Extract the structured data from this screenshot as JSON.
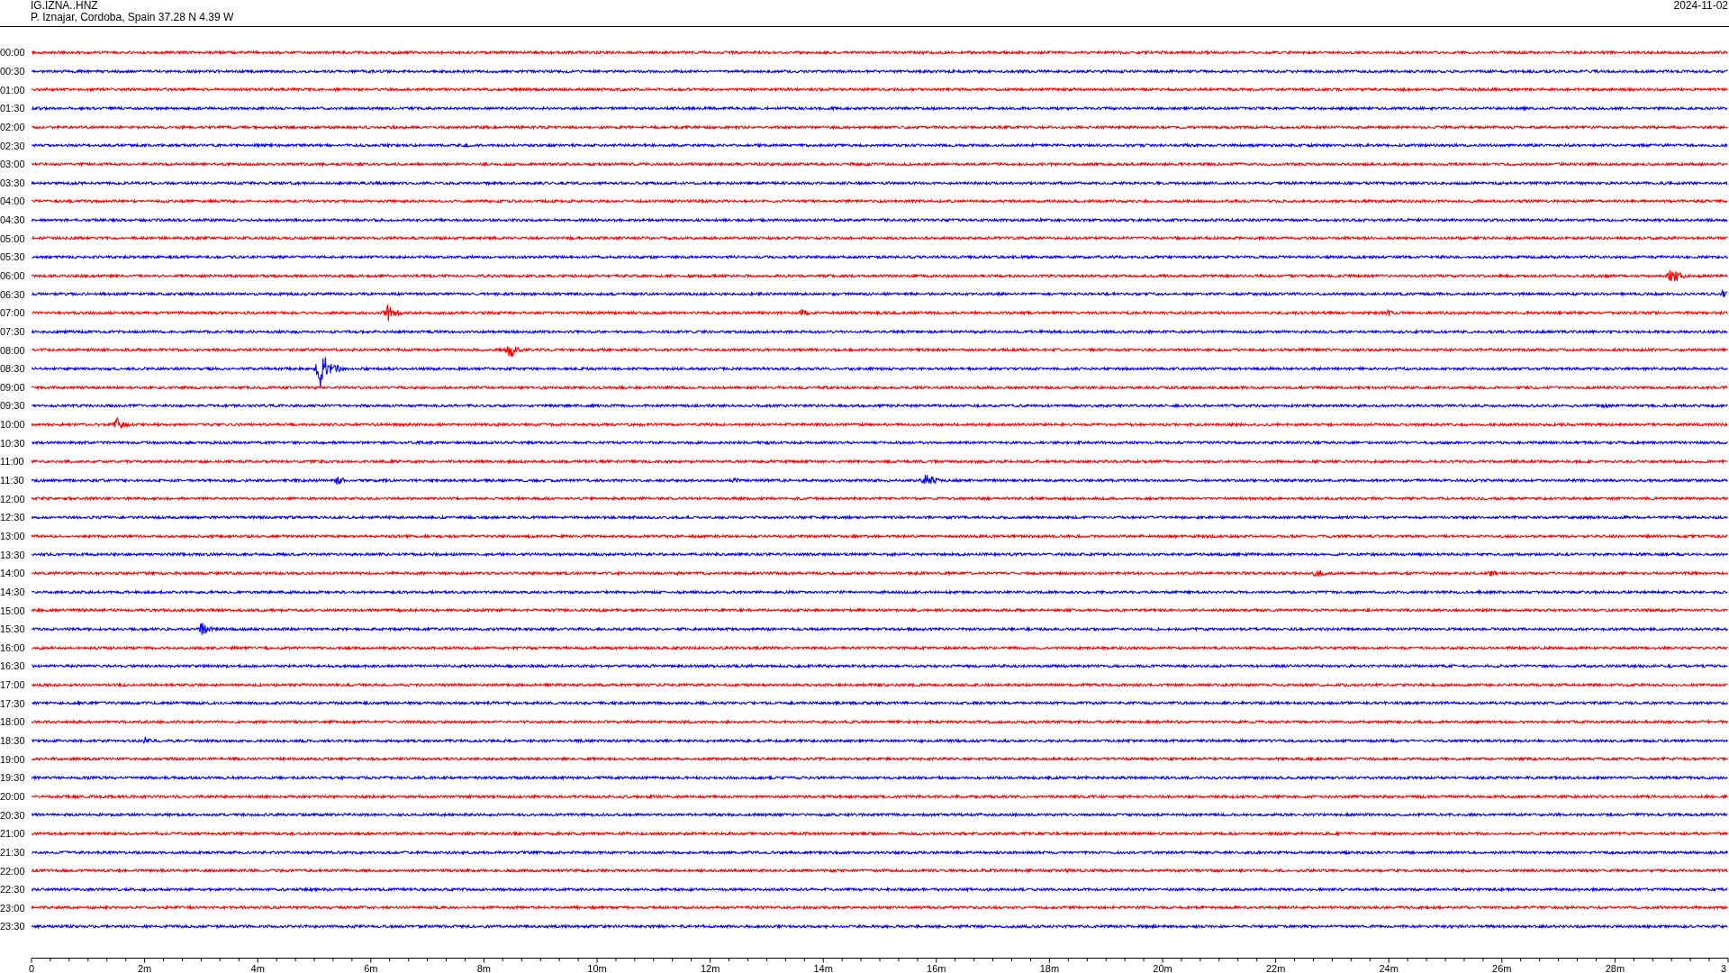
{
  "header": {
    "station": "IG.IZNA..HNZ",
    "location": "P. Iznajar, Cordoba, Spain  37.28 N 4.39 W",
    "date": "2024-11-02"
  },
  "rows": [
    {
      "label": "00:00",
      "color": "#ff0000"
    },
    {
      "label": "00:30",
      "color": "#0000ff"
    },
    {
      "label": "01:00",
      "color": "#ff0000"
    },
    {
      "label": "01:30",
      "color": "#0000ff"
    },
    {
      "label": "02:00",
      "color": "#ff0000"
    },
    {
      "label": "02:30",
      "color": "#0000ff"
    },
    {
      "label": "03:00",
      "color": "#ff0000"
    },
    {
      "label": "03:30",
      "color": "#0000ff"
    },
    {
      "label": "04:00",
      "color": "#ff0000"
    },
    {
      "label": "04:30",
      "color": "#0000ff"
    },
    {
      "label": "05:00",
      "color": "#ff0000"
    },
    {
      "label": "05:30",
      "color": "#0000ff"
    },
    {
      "label": "06:00",
      "color": "#ff0000"
    },
    {
      "label": "06:30",
      "color": "#0000ff"
    },
    {
      "label": "07:00",
      "color": "#ff0000"
    },
    {
      "label": "07:30",
      "color": "#0000ff"
    },
    {
      "label": "08:00",
      "color": "#ff0000"
    },
    {
      "label": "08:30",
      "color": "#0000ff"
    },
    {
      "label": "09:00",
      "color": "#ff0000"
    },
    {
      "label": "09:30",
      "color": "#0000ff"
    },
    {
      "label": "10:00",
      "color": "#ff0000"
    },
    {
      "label": "10:30",
      "color": "#0000ff"
    },
    {
      "label": "11:00",
      "color": "#ff0000"
    },
    {
      "label": "11:30",
      "color": "#0000ff"
    },
    {
      "label": "12:00",
      "color": "#ff0000"
    },
    {
      "label": "12:30",
      "color": "#0000ff"
    },
    {
      "label": "13:00",
      "color": "#ff0000"
    },
    {
      "label": "13:30",
      "color": "#0000ff"
    },
    {
      "label": "14:00",
      "color": "#ff0000"
    },
    {
      "label": "14:30",
      "color": "#0000ff"
    },
    {
      "label": "15:00",
      "color": "#ff0000"
    },
    {
      "label": "15:30",
      "color": "#0000ff"
    },
    {
      "label": "16:00",
      "color": "#ff0000"
    },
    {
      "label": "16:30",
      "color": "#0000ff"
    },
    {
      "label": "17:00",
      "color": "#ff0000"
    },
    {
      "label": "17:30",
      "color": "#0000ff"
    },
    {
      "label": "18:00",
      "color": "#ff0000"
    },
    {
      "label": "18:30",
      "color": "#0000ff"
    },
    {
      "label": "19:00",
      "color": "#ff0000"
    },
    {
      "label": "19:30",
      "color": "#0000ff"
    },
    {
      "label": "20:00",
      "color": "#ff0000"
    },
    {
      "label": "20:30",
      "color": "#0000ff"
    },
    {
      "label": "21:00",
      "color": "#ff0000"
    },
    {
      "label": "21:30",
      "color": "#0000ff"
    },
    {
      "label": "22:00",
      "color": "#ff0000"
    },
    {
      "label": "22:30",
      "color": "#0000ff"
    },
    {
      "label": "23:00",
      "color": "#ff0000"
    },
    {
      "label": "23:30",
      "color": "#0000ff"
    }
  ],
  "axis": {
    "ticks": [
      "0",
      "2m",
      "4m",
      "6m",
      "8m",
      "10m",
      "12m",
      "14m",
      "16m",
      "18m",
      "20m",
      "22m",
      "24m",
      "26m",
      "28m",
      "3"
    ]
  }
}
